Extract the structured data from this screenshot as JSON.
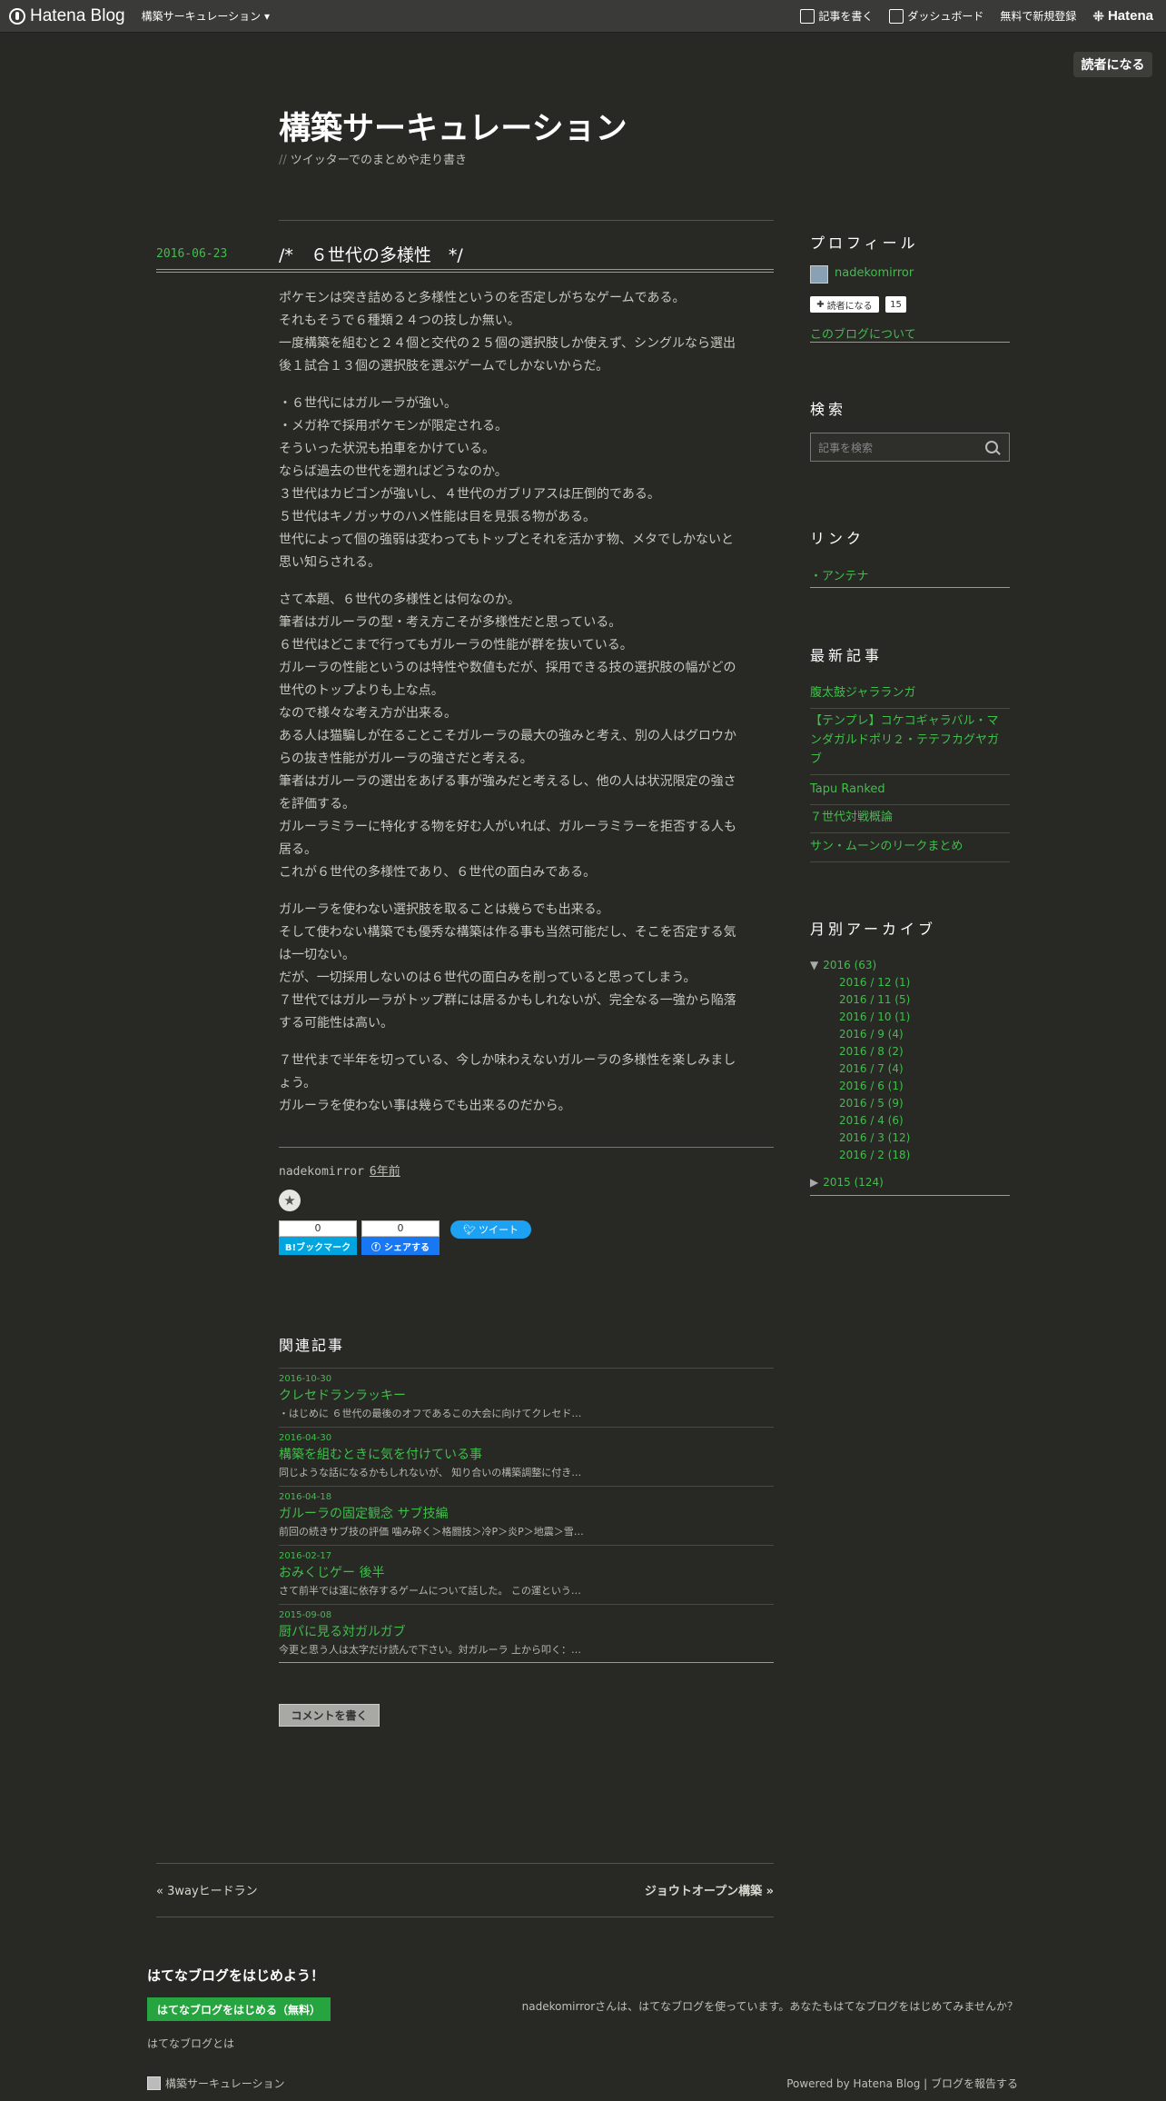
{
  "header": {
    "logo": "Hatena Blog",
    "blog_menu": "構築サーキュレーション",
    "write": "記事を書く",
    "dashboard": "ダッシュボード",
    "signup": "無料で新規登録",
    "hatena": "Hatena"
  },
  "subscribe_top": "読者になる",
  "blog": {
    "title": "構築サーキュレーション",
    "description": "ツイッターでのまとめや走り書き"
  },
  "entry": {
    "date": "2016-06-23",
    "title": "/*　６世代の多様性　*/",
    "paragraphs": [
      [
        "ポケモンは突き詰めると多様性というのを否定しがちなゲームである。",
        "それもそうで６種類２４つの技しか無い。",
        "一度構築を組むと２４個と交代の２５個の選択肢しか使えず、シングルなら選出",
        "後１試合１３個の選択肢を選ぶゲームでしかないからだ。"
      ],
      [
        "・６世代にはガルーラが強い。",
        "・メガ枠で採用ポケモンが限定される。",
        "そういった状況も拍車をかけている。",
        "ならば過去の世代を遡ればどうなのか。",
        "３世代はカビゴンが強いし、４世代のガブリアスは圧倒的である。",
        "５世代はキノガッサのハメ性能は目を見張る物がある。",
        "世代によって個の強弱は変わってもトップとそれを活かす物、メタでしかないと",
        "思い知らされる。"
      ],
      [
        "さて本題、６世代の多様性とは何なのか。",
        "筆者はガルーラの型・考え方こそが多様性だと思っている。",
        "６世代はどこまで行ってもガルーラの性能が群を抜いている。",
        "ガルーラの性能というのは特性や数値もだが、採用できる技の選択肢の幅がどの",
        "世代のトップよりも上な点。",
        "なので様々な考え方が出来る。",
        "ある人は猫騙しが在ることこそガルーラの最大の強みと考え、別の人はグロウか",
        "らの抜き性能がガルーラの強さだと考える。",
        "筆者はガルーラの選出をあげる事が強みだと考えるし、他の人は状況限定の強さ",
        "を評価する。",
        "ガルーラミラーに特化する物を好む人がいれば、ガルーラミラーを拒否する人も",
        "居る。",
        "これが６世代の多様性であり、６世代の面白みである。"
      ],
      [
        "ガルーラを使わない選択肢を取ることは幾らでも出来る。",
        "そして使わない構築でも優秀な構築は作る事も当然可能だし、そこを否定する気",
        "は一切ない。",
        "だが、一切採用しないのは６世代の面白みを削っていると思ってしまう。",
        "７世代ではガルーラがトップ群には居るかもしれないが、完全なる一強から陥落",
        "する可能性は高い。"
      ],
      [
        "７世代まで半年を切っている、今しか味わえないガルーラの多様性を楽しみまし",
        "ょう。",
        "ガルーラを使わない事は幾らでも出来るのだから。"
      ]
    ],
    "author": "nadekomirror",
    "ago": "6年前",
    "bookmark_count": "0",
    "bookmark_label": "B!ブックマーク",
    "share_count": "0",
    "share_label": "シェアする",
    "tweet_label": "ツイート"
  },
  "related": {
    "heading": "関連記事",
    "items": [
      {
        "date": "2016-10-30",
        "title": "クレセドランラッキー",
        "summary": "・はじめに ６世代の最後のオフであるこの大会に向けてクレセド…"
      },
      {
        "date": "2016-04-30",
        "title": "構築を組むときに気を付けている事",
        "summary": "同じような話になるかもしれないが、 知り合いの構築調整に付き…"
      },
      {
        "date": "2016-04-18",
        "title": "ガルーラの固定観念 サブ技編",
        "summary": "前回の続きサブ技の評価 噛み砕く＞格闘技＞冷P＞炎P＞地震＞雪…"
      },
      {
        "date": "2016-02-17",
        "title": "おみくじゲー 後半",
        "summary": "さて前半では運に依存するゲームについて話した。 この運という…"
      },
      {
        "date": "2015-09-08",
        "title": "厨パに見る対ガルガブ",
        "summary": "今更と思う人は太字だけ読んで下さい。対ガルーラ 上から叩く：…"
      }
    ]
  },
  "comment_button": "コメントを書く",
  "pager": {
    "prev": "« 3wayヒードラン",
    "next": "ジョウトオープン構築 »"
  },
  "sidebar": {
    "profile_heading": "プロフィール",
    "profile_name": "nadekomirror",
    "subscribe_label": "読者になる",
    "subscriber_count": "15",
    "about_link": "このブログについて",
    "search_heading": "検索",
    "search_placeholder": "記事を検索",
    "links_heading": "リンク",
    "antenna": "・アンテナ",
    "recent_heading": "最新記事",
    "recent": [
      "腹太鼓ジャラランガ",
      "【テンプレ】コケコギャラバル・マンダガルドポリ２・テテフカグヤガブ",
      "Tapu Ranked",
      "７世代対戦概論",
      "サン・ムーンのリークまとめ"
    ],
    "archive_heading": "月別アーカイブ",
    "archive_2016": "2016 (63)",
    "archive_months": [
      "2016 / 12 (1)",
      "2016 / 11 (5)",
      "2016 / 10 (1)",
      "2016 / 9 (4)",
      "2016 / 8 (2)",
      "2016 / 7 (4)",
      "2016 / 6 (1)",
      "2016 / 5 (9)",
      "2016 / 4 (6)",
      "2016 / 3 (12)",
      "2016 / 2 (18)"
    ],
    "archive_2015": "2015 (124)"
  },
  "footer": {
    "start_title": "はてなブログをはじめよう！",
    "start_button": "はてなブログをはじめる（無料）",
    "about": "はてなブログとは",
    "message": "nadekomirrorさんは、はてなブログを使っています。あなたもはてなブログをはじめてみませんか？",
    "blog_name": "構築サーキュレーション",
    "powered": "Powered by Hatena Blog | ブログを報告する"
  }
}
